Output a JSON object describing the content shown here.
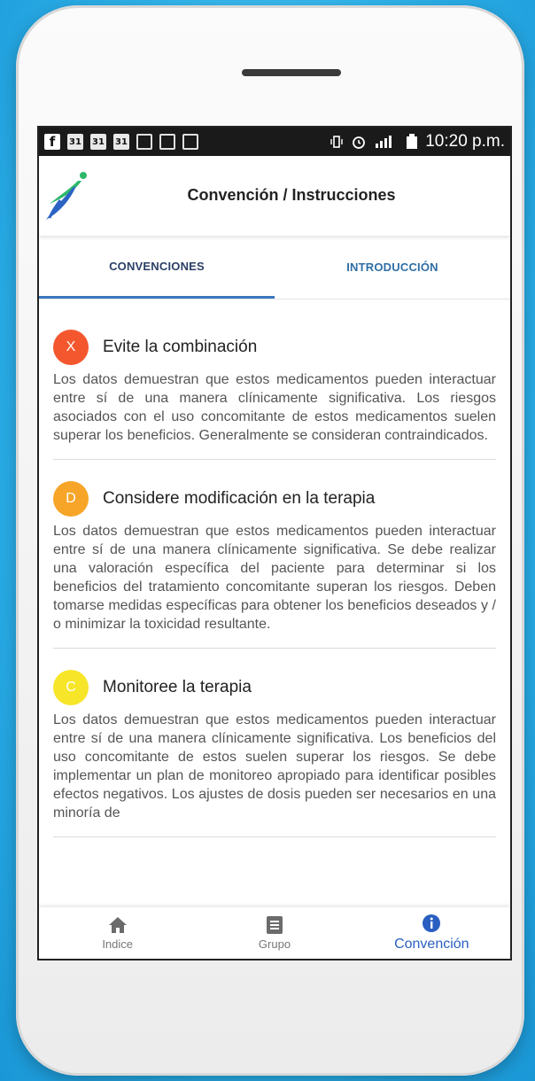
{
  "status_bar": {
    "time": "10:20 p.m.",
    "left_icons": [
      "facebook-icon",
      "calendar-icon",
      "calendar-icon",
      "calendar-icon",
      "image-icon",
      "image-icon",
      "image-icon"
    ],
    "calendar_text": "31",
    "facebook_text": "f"
  },
  "app_bar": {
    "title": "Convención / Instrucciones"
  },
  "tabs": [
    {
      "label": "CONVENCIONES",
      "active": true
    },
    {
      "label": "INTRODUCCIÓN",
      "active": false
    }
  ],
  "sections": [
    {
      "badge": "X",
      "badge_color": "#f4572e",
      "title": "Evite la combinación",
      "body": "Los datos demuestran que estos medicamentos pueden interactuar entre sí de una manera clínicamente significativa. Los riesgos asociados con el uso concomitante de estos medicamentos suelen superar los beneficios. Generalmente se consideran contraindicados."
    },
    {
      "badge": "D",
      "badge_color": "#f7a528",
      "title": "Considere modificación en la terapia",
      "body": "Los datos demuestran que estos medicamentos pueden interactuar entre sí de una manera clínicamente significativa. Se debe realizar una valoración específica del paciente para determinar si los beneficios del tratamiento concomitante superan los riesgos. Deben tomarse medidas específicas para obtener los beneficios deseados y / o minimizar la toxicidad resultante."
    },
    {
      "badge": "C",
      "badge_color": "#f7e52a",
      "title": "Monitoree la terapia",
      "body": "Los datos demuestran que estos medicamentos pueden interactuar entre sí de una manera clínicamente significativa. Los beneficios del uso concomitante de estos suelen superar los riesgos. Se debe implementar un plan de monitoreo apropiado para identificar posibles efectos negativos. Los ajustes de dosis pueden ser necesarios en una minoría de"
    }
  ],
  "bottom_nav": [
    {
      "label": "Indice",
      "icon": "home-icon",
      "active": false
    },
    {
      "label": "Grupo",
      "icon": "list-icon",
      "active": false
    },
    {
      "label": "Convención",
      "icon": "info-icon",
      "active": true
    }
  ],
  "colors": {
    "accent": "#3b77c0",
    "active_nav": "#2a5fc1"
  }
}
